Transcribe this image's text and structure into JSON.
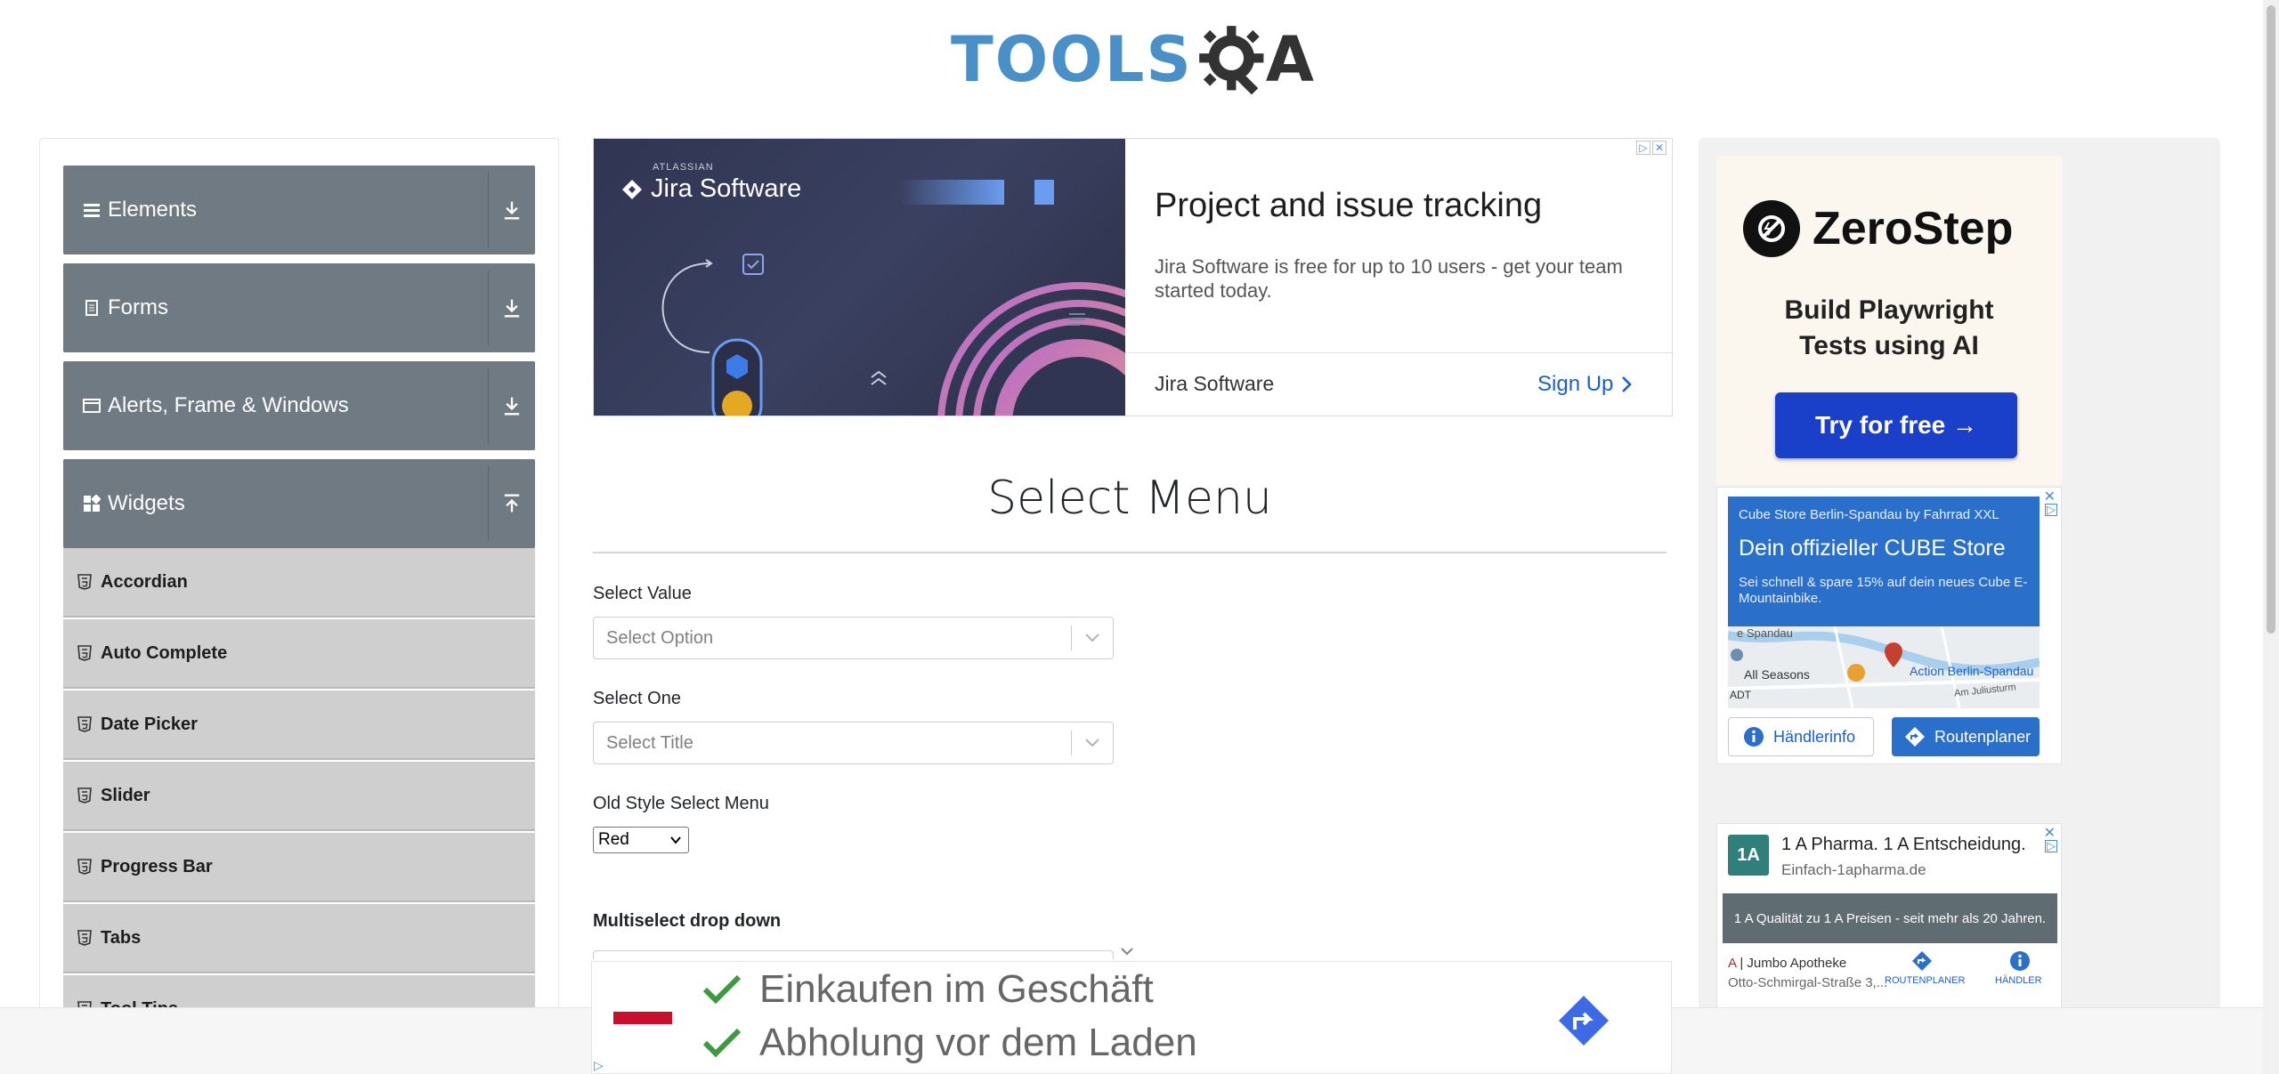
{
  "header": {
    "logo_text_left": "TOOLS",
    "logo_text_right": "A"
  },
  "sidebar": {
    "groups": [
      {
        "label": "Elements",
        "icon": "hamburger-icon"
      },
      {
        "label": "Forms",
        "icon": "document-icon"
      },
      {
        "label": "Alerts, Frame & Windows",
        "icon": "window-icon"
      },
      {
        "label": "Widgets",
        "icon": "widgets-icon"
      }
    ],
    "items": [
      "Accordian",
      "Auto Complete",
      "Date Picker",
      "Slider",
      "Progress Bar",
      "Tabs",
      "Tool Tips"
    ]
  },
  "top_ad": {
    "brand_small": "ATLASSIAN",
    "brand_logo": "Jira Software",
    "title": "Project and issue tracking",
    "description": "Jira Software is free for up to 10 users - get your team started today.",
    "footer_brand": "Jira Software",
    "cta": "Sign Up"
  },
  "main": {
    "title": "Select Menu",
    "select_value_label": "Select Value",
    "select_value_placeholder": "Select Option",
    "select_one_label": "Select One",
    "select_one_placeholder": "Select Title",
    "old_style_label": "Old Style Select Menu",
    "old_style_value": "Red",
    "multiselect_label": "Multiselect drop down"
  },
  "right_ads": {
    "zerostep": {
      "brand": "ZeroStep",
      "headline_1": "Build Playwright",
      "headline_2": "Tests using AI",
      "cta": "Try for free →"
    },
    "cube": {
      "advertiser": "Cube Store Berlin-Spandau by Fahrrad XXL",
      "title": "Dein offizieller CUBE Store",
      "desc": "Sei schnell & spare 15% auf dein neues Cube E-Mountainbike.",
      "map_label_1": "All Seasons",
      "map_label_2": "Action Berlin-Spandau",
      "map_label_3": "Am Juliusturm",
      "map_label_4": "e Spandau",
      "map_label_5": "ADT",
      "btn_info": "Händlerinfo",
      "btn_route": "Routenplaner"
    },
    "pharma": {
      "logo": "1A",
      "title": "1 A Pharma. 1 A Entscheidung.",
      "url": "Einfach-1apharma.de",
      "banner": "1 A Qualität zu 1 A Preisen - seit mehr als 20 Jahren.",
      "store_prefix": "A",
      "store": "Jumbo Apotheke",
      "address": "Otto-Schmirgal-Straße 3,...",
      "link_route": "ROUTENPLANER",
      "link_dealer": "HÄNDLER"
    }
  },
  "bottom_ad": {
    "line_1": "Einkaufen im Geschäft",
    "line_2": "Abholung vor dem Laden"
  },
  "colors": {
    "sidebar_header": "#707a83",
    "sidebar_item": "#cfcfcf",
    "accent_blue": "#1a5fd1",
    "zerostep_button": "#1a3fc9"
  }
}
